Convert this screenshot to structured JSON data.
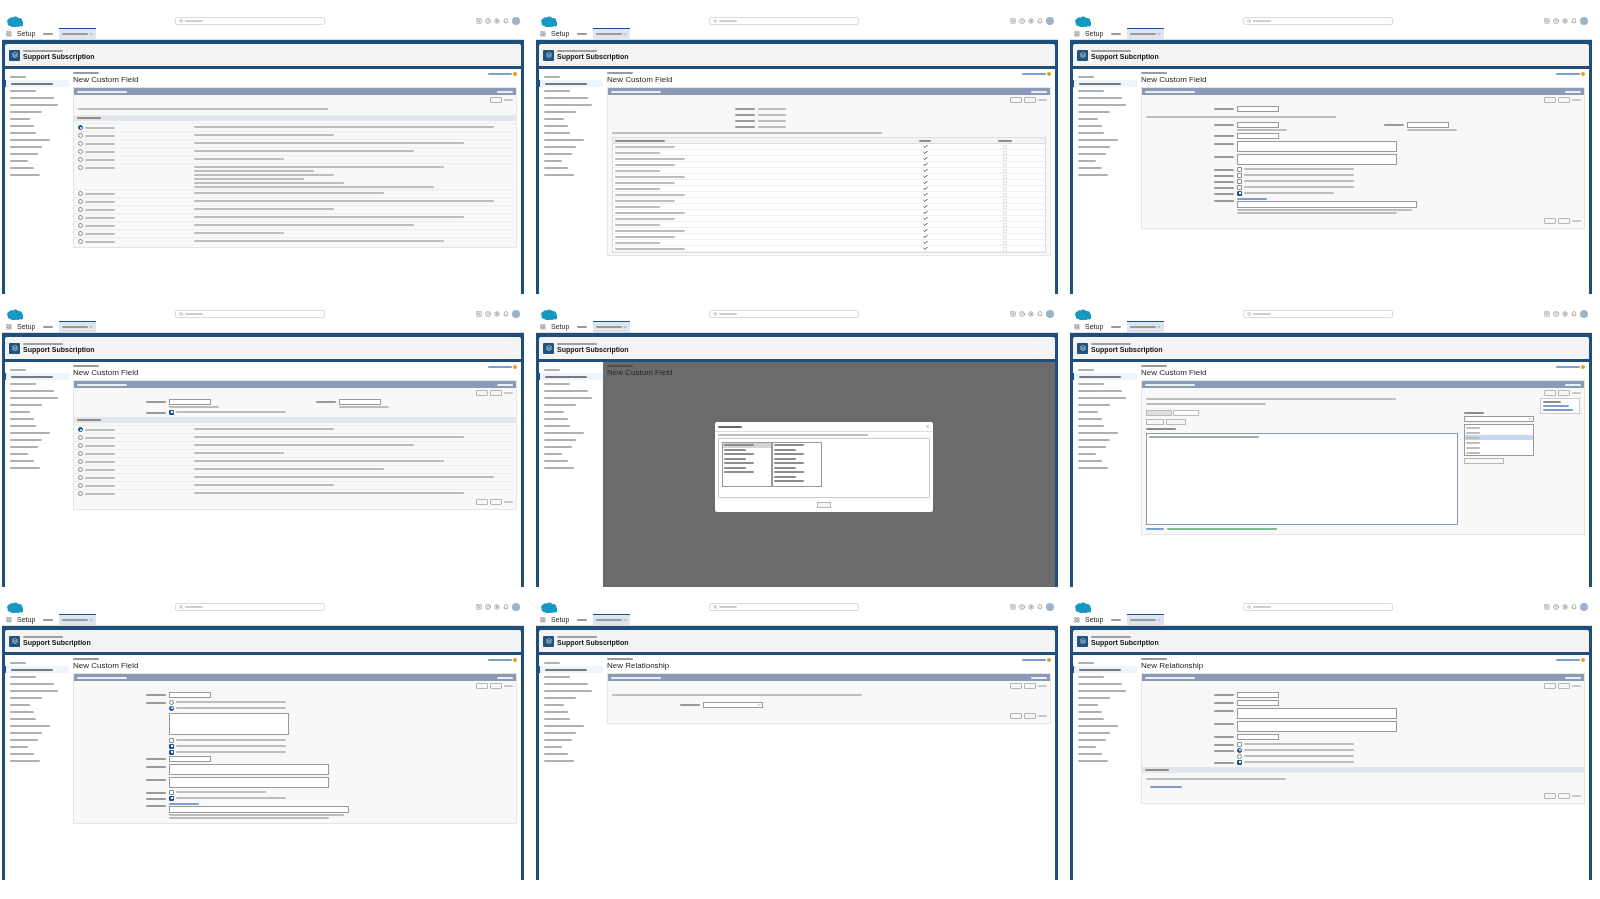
{
  "tiles": [
    {
      "shell": {
        "app": "Setup",
        "object": "Support Subscription",
        "tabs": [
          {
            "selected": false
          },
          {
            "selected": true
          }
        ],
        "sidebar": [
          {
            "selected": false
          },
          {
            "selected": true
          },
          {
            "selected": false
          },
          {
            "selected": false
          },
          {
            "selected": false
          },
          {
            "selected": false
          },
          {
            "selected": false
          },
          {
            "selected": false
          },
          {
            "selected": false
          },
          {
            "selected": false
          },
          {
            "selected": false
          },
          {
            "selected": false
          },
          {
            "selected": false
          },
          {
            "selected": false
          },
          {
            "selected": false
          }
        ]
      },
      "page": {
        "kind": "form",
        "title": "New Custom Field",
        "buttons": [
          {
            "kind": "button"
          },
          {
            "kind": "link"
          }
        ],
        "rows": [
          {
            "kind": "paragraph"
          },
          {
            "kind": "section"
          },
          {
            "kind": "option",
            "selected": true
          },
          {
            "kind": "option",
            "selected": false
          },
          {
            "kind": "option",
            "selected": false
          },
          {
            "kind": "option",
            "selected": false
          },
          {
            "kind": "option",
            "selected": false
          },
          {
            "kind": "option_long",
            "selected": false
          },
          {
            "kind": "option",
            "selected": false
          },
          {
            "kind": "option",
            "selected": false
          },
          {
            "kind": "option",
            "selected": false
          },
          {
            "kind": "option",
            "selected": false
          },
          {
            "kind": "option",
            "selected": false
          },
          {
            "kind": "option",
            "selected": false
          },
          {
            "kind": "option",
            "selected": false
          }
        ]
      }
    },
    {
      "shell": {
        "app": "Setup",
        "object": "Support Subscription",
        "tabs": [
          {
            "selected": false
          },
          {
            "selected": true
          }
        ],
        "sidebar": [
          {
            "selected": false
          },
          {
            "selected": true
          },
          {
            "selected": false
          },
          {
            "selected": false
          },
          {
            "selected": false
          },
          {
            "selected": false
          },
          {
            "selected": false
          },
          {
            "selected": false
          },
          {
            "selected": false
          },
          {
            "selected": false
          },
          {
            "selected": false
          },
          {
            "selected": false
          },
          {
            "selected": false
          },
          {
            "selected": false
          },
          {
            "selected": false
          }
        ]
      },
      "page": {
        "kind": "form",
        "title": "New Custom Field",
        "buttons": [
          {
            "kind": "button"
          },
          {
            "kind": "button"
          },
          {
            "kind": "link"
          }
        ],
        "rows": [
          {
            "kind": "pair"
          },
          {
            "kind": "pair"
          },
          {
            "kind": "pair"
          },
          {
            "kind": "pair"
          },
          {
            "kind": "paragraph"
          },
          {
            "kind": "table",
            "rows": [
              {
                "visible": true,
                "read_only": false
              },
              {
                "visible": true,
                "read_only": false
              },
              {
                "visible": true,
                "read_only": false
              },
              {
                "visible": true,
                "read_only": false
              },
              {
                "visible": true,
                "read_only": false
              },
              {
                "visible": true,
                "read_only": false
              },
              {
                "visible": true,
                "read_only": false
              },
              {
                "visible": true,
                "read_only": false
              },
              {
                "visible": true,
                "read_only": false
              },
              {
                "visible": true,
                "read_only": false
              },
              {
                "visible": true,
                "read_only": false
              },
              {
                "visible": true,
                "read_only": false
              },
              {
                "visible": true,
                "read_only": false
              },
              {
                "visible": true,
                "read_only": false
              },
              {
                "visible": true,
                "read_only": false
              },
              {
                "visible": true,
                "read_only": false
              },
              {
                "visible": true,
                "read_only": false
              },
              {
                "visible": true,
                "read_only": false
              }
            ]
          }
        ]
      }
    },
    {
      "shell": {
        "app": "Setup",
        "object": "Support Subcription",
        "tabs": [
          {
            "selected": false
          },
          {
            "selected": true
          }
        ],
        "sidebar": [
          {
            "selected": false
          },
          {
            "selected": true
          },
          {
            "selected": false
          },
          {
            "selected": false
          },
          {
            "selected": false
          },
          {
            "selected": false
          },
          {
            "selected": false
          },
          {
            "selected": false
          },
          {
            "selected": false
          },
          {
            "selected": false
          },
          {
            "selected": false
          },
          {
            "selected": false
          },
          {
            "selected": false
          },
          {
            "selected": false
          },
          {
            "selected": false
          }
        ]
      },
      "page": {
        "kind": "form",
        "title": "New Custom Field",
        "buttons": [
          {
            "kind": "button"
          },
          {
            "kind": "button"
          },
          {
            "kind": "link"
          }
        ],
        "rows": [
          {
            "kind": "input"
          },
          {
            "kind": "paragraph"
          },
          {
            "kind": "input_pair"
          },
          {
            "kind": "input"
          },
          {
            "kind": "textarea"
          },
          {
            "kind": "textarea"
          },
          {
            "kind": "checkbox",
            "labeled": true,
            "checked": false
          },
          {
            "kind": "checkbox",
            "labeled": true,
            "checked": false
          },
          {
            "kind": "checkbox",
            "labeled": true,
            "checked": false
          },
          {
            "kind": "checkbox",
            "labeled": true,
            "checked": false
          },
          {
            "kind": "checkbox",
            "labeled": true,
            "checked": true
          },
          {
            "kind": "default_value"
          }
        ],
        "bottom_buttons": [
          {
            "kind": "button"
          },
          {
            "kind": "button"
          },
          {
            "kind": "link"
          }
        ]
      }
    },
    {
      "shell": {
        "app": "Setup",
        "object": "Support Subscription",
        "tabs": [
          {
            "selected": false
          },
          {
            "selected": true
          }
        ],
        "sidebar": [
          {
            "selected": false
          },
          {
            "selected": true
          },
          {
            "selected": false
          },
          {
            "selected": false
          },
          {
            "selected": false
          },
          {
            "selected": false
          },
          {
            "selected": false
          },
          {
            "selected": false
          },
          {
            "selected": false
          },
          {
            "selected": false
          },
          {
            "selected": false
          },
          {
            "selected": false
          },
          {
            "selected": false
          },
          {
            "selected": false
          },
          {
            "selected": false
          }
        ]
      },
      "page": {
        "kind": "form",
        "title": "New Custom Field",
        "buttons": [
          {
            "kind": "button"
          },
          {
            "kind": "button"
          },
          {
            "kind": "link"
          }
        ],
        "rows": [
          {
            "kind": "input_pair"
          },
          {
            "kind": "checkbox",
            "labeled": true,
            "checked": true
          },
          {
            "kind": "section"
          },
          {
            "kind": "option",
            "selected": true
          },
          {
            "kind": "option",
            "selected": false
          },
          {
            "kind": "option",
            "selected": false
          },
          {
            "kind": "option",
            "selected": false
          },
          {
            "kind": "option",
            "selected": false
          },
          {
            "kind": "option",
            "selected": false
          },
          {
            "kind": "option",
            "selected": false
          },
          {
            "kind": "option",
            "selected": false
          },
          {
            "kind": "option",
            "selected": false
          }
        ],
        "bottom_buttons": [
          {
            "kind": "button"
          },
          {
            "kind": "button"
          },
          {
            "kind": "link"
          }
        ]
      }
    },
    {
      "shell": {
        "app": "Setup",
        "object": "Support Subscription",
        "tabs": [
          {
            "selected": false
          },
          {
            "selected": true
          }
        ],
        "sidebar": [
          {
            "selected": false
          },
          {
            "selected": true
          },
          {
            "selected": false
          },
          {
            "selected": false
          },
          {
            "selected": false
          },
          {
            "selected": false
          },
          {
            "selected": false
          },
          {
            "selected": false
          },
          {
            "selected": false
          },
          {
            "selected": false
          },
          {
            "selected": false
          },
          {
            "selected": false
          },
          {
            "selected": false
          },
          {
            "selected": false
          },
          {
            "selected": false
          }
        ]
      },
      "page": {
        "kind": "dialog",
        "title": "New Custom Field",
        "lists": [
          [
            {
              "selected": true
            },
            {
              "selected": false
            },
            {
              "selected": false
            },
            {
              "selected": false
            },
            {
              "selected": false
            },
            {
              "selected": false
            },
            {
              "selected": false
            }
          ],
          [
            {
              "selected": false
            },
            {
              "selected": false
            },
            {
              "selected": false
            },
            {
              "selected": false
            },
            {
              "selected": false
            },
            {
              "selected": false
            },
            {
              "selected": false
            },
            {
              "selected": false
            },
            {
              "selected": false
            }
          ]
        ]
      }
    },
    {
      "shell": {
        "app": "Setup",
        "object": "Support Subscription",
        "tabs": [
          {
            "selected": false
          },
          {
            "selected": true
          }
        ],
        "sidebar": [
          {
            "selected": false
          },
          {
            "selected": true
          },
          {
            "selected": false
          },
          {
            "selected": false
          },
          {
            "selected": false
          },
          {
            "selected": false
          },
          {
            "selected": false
          },
          {
            "selected": false
          },
          {
            "selected": false
          },
          {
            "selected": false
          },
          {
            "selected": false
          },
          {
            "selected": false
          },
          {
            "selected": false
          },
          {
            "selected": false
          },
          {
            "selected": false
          }
        ]
      },
      "page": {
        "kind": "formula",
        "title": "New Custom Field",
        "buttons": [
          {
            "kind": "button"
          },
          {
            "kind": "button"
          },
          {
            "kind": "link"
          }
        ],
        "tabs": [
          {
            "selected": false
          },
          {
            "selected": true
          }
        ],
        "functions": [
          {
            "selected": false
          },
          {
            "selected": false
          },
          {
            "selected": true
          },
          {
            "selected": false
          },
          {
            "selected": false
          },
          {
            "selected": false
          }
        ]
      }
    },
    {
      "shell": {
        "app": "Setup",
        "object": "Support Subcription",
        "tabs": [
          {
            "selected": false
          },
          {
            "selected": true
          }
        ],
        "sidebar": [
          {
            "selected": false
          },
          {
            "selected": true
          },
          {
            "selected": false
          },
          {
            "selected": false
          },
          {
            "selected": false
          },
          {
            "selected": false
          },
          {
            "selected": false
          },
          {
            "selected": false
          },
          {
            "selected": false
          },
          {
            "selected": false
          },
          {
            "selected": false
          },
          {
            "selected": false
          },
          {
            "selected": false
          },
          {
            "selected": false
          },
          {
            "selected": false
          }
        ]
      },
      "page": {
        "kind": "form",
        "title": "New Custom Field",
        "buttons": [
          {
            "kind": "button"
          },
          {
            "kind": "button"
          },
          {
            "kind": "link"
          }
        ],
        "rows": [
          {
            "kind": "input"
          },
          {
            "kind": "radio",
            "labeled": true,
            "selected": false
          },
          {
            "kind": "radio",
            "labeled": false,
            "selected": true
          },
          {
            "kind": "picklist"
          },
          {
            "kind": "checkbox",
            "labeled": false,
            "checked": false
          },
          {
            "kind": "checkbox",
            "labeled": false,
            "checked": true
          },
          {
            "kind": "checkbox",
            "labeled": false,
            "checked": true
          },
          {
            "kind": "input"
          },
          {
            "kind": "textarea"
          },
          {
            "kind": "textarea"
          },
          {
            "kind": "checkbox",
            "labeled": true,
            "checked": false
          },
          {
            "kind": "checkbox",
            "labeled": true,
            "checked": true
          },
          {
            "kind": "default_value"
          }
        ]
      }
    },
    {
      "shell": {
        "app": "Setup",
        "object": "Support Subscription",
        "tabs": [
          {
            "selected": false
          },
          {
            "selected": true
          }
        ],
        "sidebar": [
          {
            "selected": false
          },
          {
            "selected": true
          },
          {
            "selected": false
          },
          {
            "selected": false
          },
          {
            "selected": false
          },
          {
            "selected": false
          },
          {
            "selected": false
          },
          {
            "selected": false
          },
          {
            "selected": false
          },
          {
            "selected": false
          },
          {
            "selected": false
          },
          {
            "selected": false
          },
          {
            "selected": false
          },
          {
            "selected": false
          },
          {
            "selected": false
          }
        ]
      },
      "page": {
        "kind": "form",
        "title": "New Relationship",
        "buttons": [
          {
            "kind": "button"
          },
          {
            "kind": "button"
          },
          {
            "kind": "link"
          }
        ],
        "rows": [
          {
            "kind": "paragraph"
          },
          {
            "kind": "select"
          }
        ],
        "bottom_buttons": [
          {
            "kind": "button"
          },
          {
            "kind": "button"
          },
          {
            "kind": "link"
          }
        ]
      }
    },
    {
      "shell": {
        "app": "Setup",
        "object": "Support Subcription",
        "tabs": [
          {
            "selected": false
          },
          {
            "selected": true
          }
        ],
        "sidebar": [
          {
            "selected": false
          },
          {
            "selected": true
          },
          {
            "selected": false
          },
          {
            "selected": false
          },
          {
            "selected": false
          },
          {
            "selected": false
          },
          {
            "selected": false
          },
          {
            "selected": false
          },
          {
            "selected": false
          },
          {
            "selected": false
          },
          {
            "selected": false
          },
          {
            "selected": false
          },
          {
            "selected": false
          },
          {
            "selected": false
          },
          {
            "selected": false
          }
        ]
      },
      "page": {
        "kind": "form",
        "title": "New Relationship",
        "buttons": [
          {
            "kind": "button"
          },
          {
            "kind": "button"
          },
          {
            "kind": "link"
          }
        ],
        "rows": [
          {
            "kind": "input"
          },
          {
            "kind": "input"
          },
          {
            "kind": "textarea"
          },
          {
            "kind": "textarea"
          },
          {
            "kind": "input"
          },
          {
            "kind": "checkbox",
            "labeled": true,
            "checked": false
          },
          {
            "kind": "radio",
            "labeled": true,
            "selected": true
          },
          {
            "kind": "radio",
            "labeled": false,
            "selected": false
          },
          {
            "kind": "checkbox",
            "labeled": true,
            "checked": true
          },
          {
            "kind": "section"
          },
          {
            "kind": "paragraph"
          },
          {
            "kind": "link"
          }
        ],
        "bottom_buttons": [
          {
            "kind": "button"
          },
          {
            "kind": "button"
          },
          {
            "kind": "link"
          }
        ]
      }
    }
  ]
}
